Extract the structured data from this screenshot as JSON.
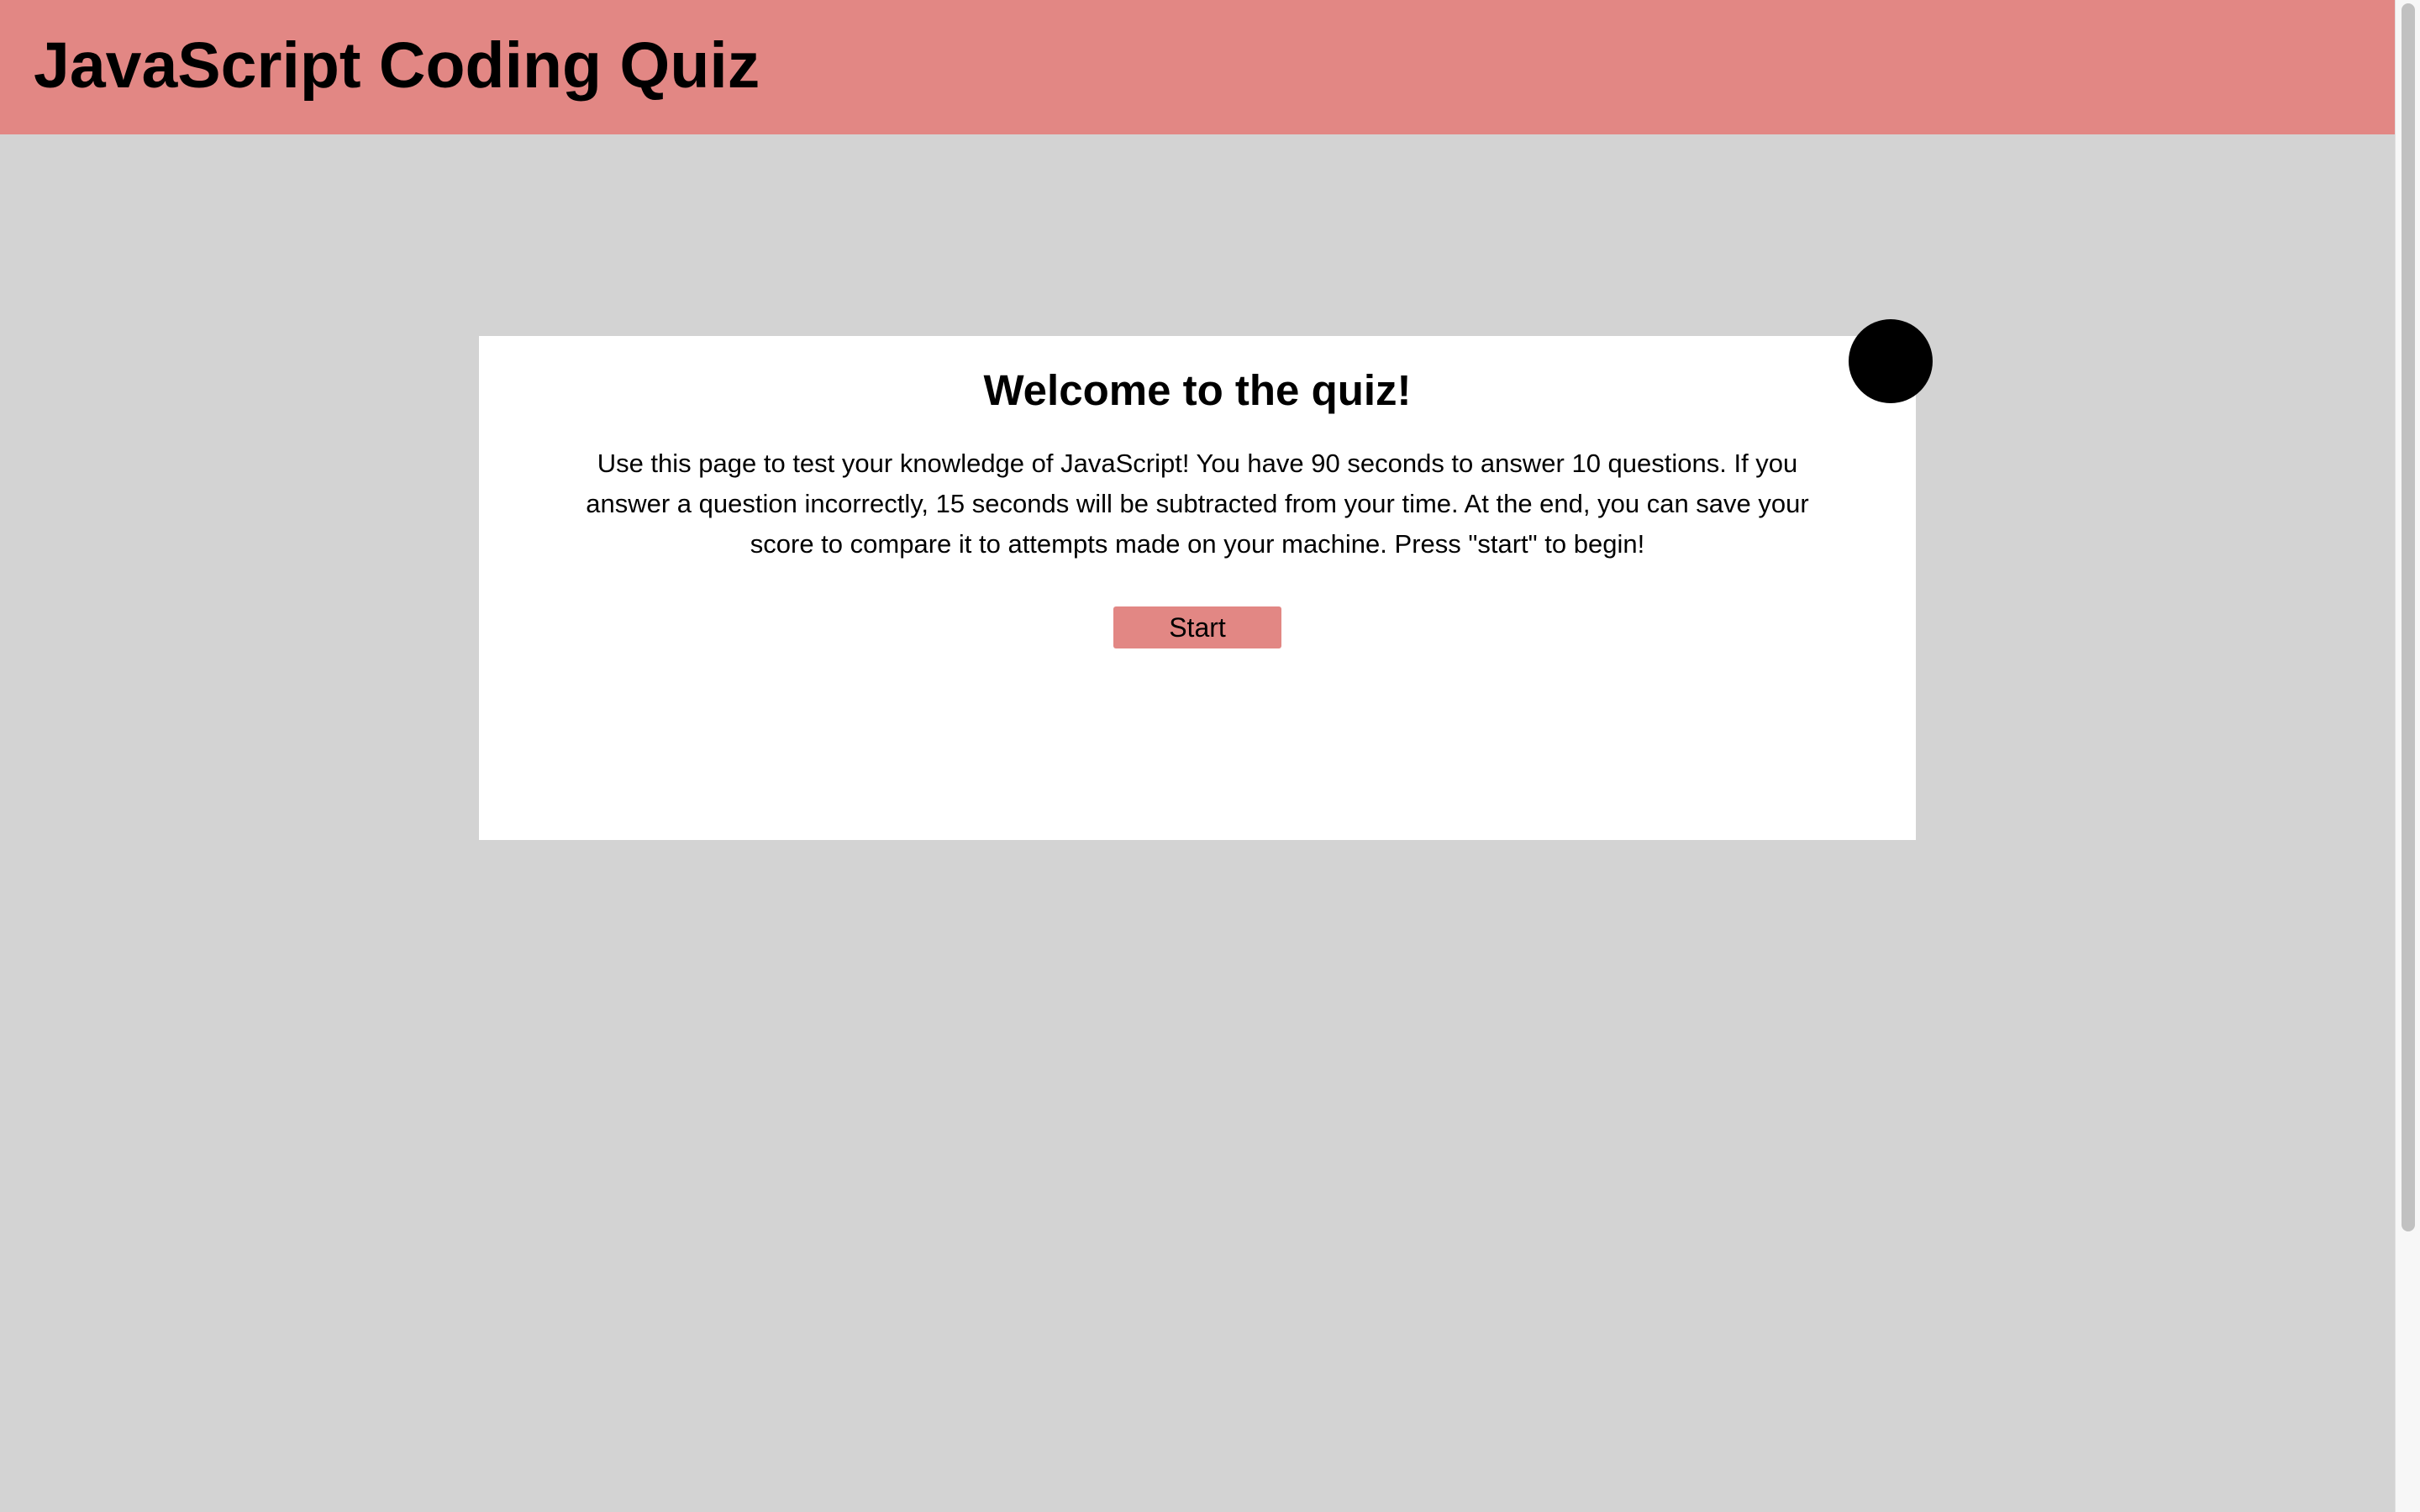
{
  "header": {
    "title": "JavaScript Coding Quiz",
    "background_color": "#e28784"
  },
  "intro_card": {
    "heading": "Welcome to the quiz!",
    "description": "Use this page to test your knowledge of JavaScript! You have 90 seconds to answer 10 questions. If you answer a question incorrectly, 15 seconds will be subtracted from your time. At the end, you can save your score to compare it to attempts made on your machine. Press \"start\" to begin!",
    "start_label": "Start"
  },
  "timer": {
    "icon": "timer-circle-icon",
    "color": "#000000"
  },
  "page": {
    "background_color": "#d3d3d3",
    "accent_color": "#e28784"
  }
}
